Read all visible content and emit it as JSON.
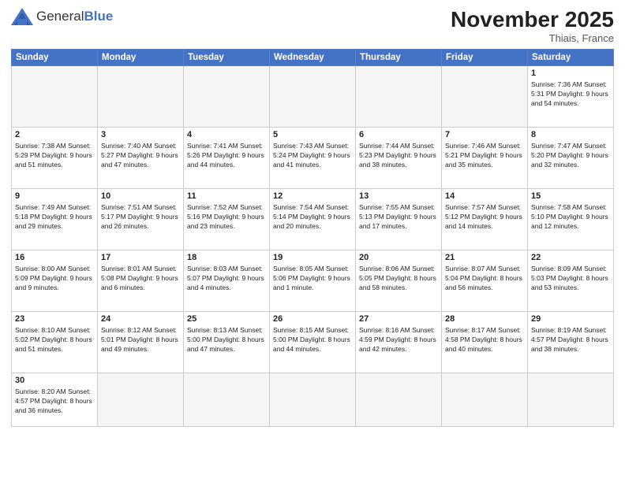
{
  "logo": {
    "text_general": "General",
    "text_blue": "Blue"
  },
  "title": "November 2025",
  "location": "Thiais, France",
  "days_of_week": [
    "Sunday",
    "Monday",
    "Tuesday",
    "Wednesday",
    "Thursday",
    "Friday",
    "Saturday"
  ],
  "weeks": [
    [
      {
        "day": "",
        "info": "",
        "empty": true
      },
      {
        "day": "",
        "info": "",
        "empty": true
      },
      {
        "day": "",
        "info": "",
        "empty": true
      },
      {
        "day": "",
        "info": "",
        "empty": true
      },
      {
        "day": "",
        "info": "",
        "empty": true
      },
      {
        "day": "",
        "info": "",
        "empty": true
      },
      {
        "day": "1",
        "info": "Sunrise: 7:36 AM\nSunset: 5:31 PM\nDaylight: 9 hours\nand 54 minutes."
      }
    ],
    [
      {
        "day": "2",
        "info": "Sunrise: 7:38 AM\nSunset: 5:29 PM\nDaylight: 9 hours\nand 51 minutes."
      },
      {
        "day": "3",
        "info": "Sunrise: 7:40 AM\nSunset: 5:27 PM\nDaylight: 9 hours\nand 47 minutes."
      },
      {
        "day": "4",
        "info": "Sunrise: 7:41 AM\nSunset: 5:26 PM\nDaylight: 9 hours\nand 44 minutes."
      },
      {
        "day": "5",
        "info": "Sunrise: 7:43 AM\nSunset: 5:24 PM\nDaylight: 9 hours\nand 41 minutes."
      },
      {
        "day": "6",
        "info": "Sunrise: 7:44 AM\nSunset: 5:23 PM\nDaylight: 9 hours\nand 38 minutes."
      },
      {
        "day": "7",
        "info": "Sunrise: 7:46 AM\nSunset: 5:21 PM\nDaylight: 9 hours\nand 35 minutes."
      },
      {
        "day": "8",
        "info": "Sunrise: 7:47 AM\nSunset: 5:20 PM\nDaylight: 9 hours\nand 32 minutes."
      }
    ],
    [
      {
        "day": "9",
        "info": "Sunrise: 7:49 AM\nSunset: 5:18 PM\nDaylight: 9 hours\nand 29 minutes."
      },
      {
        "day": "10",
        "info": "Sunrise: 7:51 AM\nSunset: 5:17 PM\nDaylight: 9 hours\nand 26 minutes."
      },
      {
        "day": "11",
        "info": "Sunrise: 7:52 AM\nSunset: 5:16 PM\nDaylight: 9 hours\nand 23 minutes."
      },
      {
        "day": "12",
        "info": "Sunrise: 7:54 AM\nSunset: 5:14 PM\nDaylight: 9 hours\nand 20 minutes."
      },
      {
        "day": "13",
        "info": "Sunrise: 7:55 AM\nSunset: 5:13 PM\nDaylight: 9 hours\nand 17 minutes."
      },
      {
        "day": "14",
        "info": "Sunrise: 7:57 AM\nSunset: 5:12 PM\nDaylight: 9 hours\nand 14 minutes."
      },
      {
        "day": "15",
        "info": "Sunrise: 7:58 AM\nSunset: 5:10 PM\nDaylight: 9 hours\nand 12 minutes."
      }
    ],
    [
      {
        "day": "16",
        "info": "Sunrise: 8:00 AM\nSunset: 5:09 PM\nDaylight: 9 hours\nand 9 minutes."
      },
      {
        "day": "17",
        "info": "Sunrise: 8:01 AM\nSunset: 5:08 PM\nDaylight: 9 hours\nand 6 minutes."
      },
      {
        "day": "18",
        "info": "Sunrise: 8:03 AM\nSunset: 5:07 PM\nDaylight: 9 hours\nand 4 minutes."
      },
      {
        "day": "19",
        "info": "Sunrise: 8:05 AM\nSunset: 5:06 PM\nDaylight: 9 hours\nand 1 minute."
      },
      {
        "day": "20",
        "info": "Sunrise: 8:06 AM\nSunset: 5:05 PM\nDaylight: 8 hours\nand 58 minutes."
      },
      {
        "day": "21",
        "info": "Sunrise: 8:07 AM\nSunset: 5:04 PM\nDaylight: 8 hours\nand 56 minutes."
      },
      {
        "day": "22",
        "info": "Sunrise: 8:09 AM\nSunset: 5:03 PM\nDaylight: 8 hours\nand 53 minutes."
      }
    ],
    [
      {
        "day": "23",
        "info": "Sunrise: 8:10 AM\nSunset: 5:02 PM\nDaylight: 8 hours\nand 51 minutes."
      },
      {
        "day": "24",
        "info": "Sunrise: 8:12 AM\nSunset: 5:01 PM\nDaylight: 8 hours\nand 49 minutes."
      },
      {
        "day": "25",
        "info": "Sunrise: 8:13 AM\nSunset: 5:00 PM\nDaylight: 8 hours\nand 47 minutes."
      },
      {
        "day": "26",
        "info": "Sunrise: 8:15 AM\nSunset: 5:00 PM\nDaylight: 8 hours\nand 44 minutes."
      },
      {
        "day": "27",
        "info": "Sunrise: 8:16 AM\nSunset: 4:59 PM\nDaylight: 8 hours\nand 42 minutes."
      },
      {
        "day": "28",
        "info": "Sunrise: 8:17 AM\nSunset: 4:58 PM\nDaylight: 8 hours\nand 40 minutes."
      },
      {
        "day": "29",
        "info": "Sunrise: 8:19 AM\nSunset: 4:57 PM\nDaylight: 8 hours\nand 38 minutes."
      }
    ],
    [
      {
        "day": "30",
        "info": "Sunrise: 8:20 AM\nSunset: 4:57 PM\nDaylight: 8 hours\nand 36 minutes.",
        "last": true
      },
      {
        "day": "",
        "info": "",
        "empty": true,
        "last": true
      },
      {
        "day": "",
        "info": "",
        "empty": true,
        "last": true
      },
      {
        "day": "",
        "info": "",
        "empty": true,
        "last": true
      },
      {
        "day": "",
        "info": "",
        "empty": true,
        "last": true
      },
      {
        "day": "",
        "info": "",
        "empty": true,
        "last": true
      },
      {
        "day": "",
        "info": "",
        "empty": true,
        "last": true
      }
    ]
  ]
}
